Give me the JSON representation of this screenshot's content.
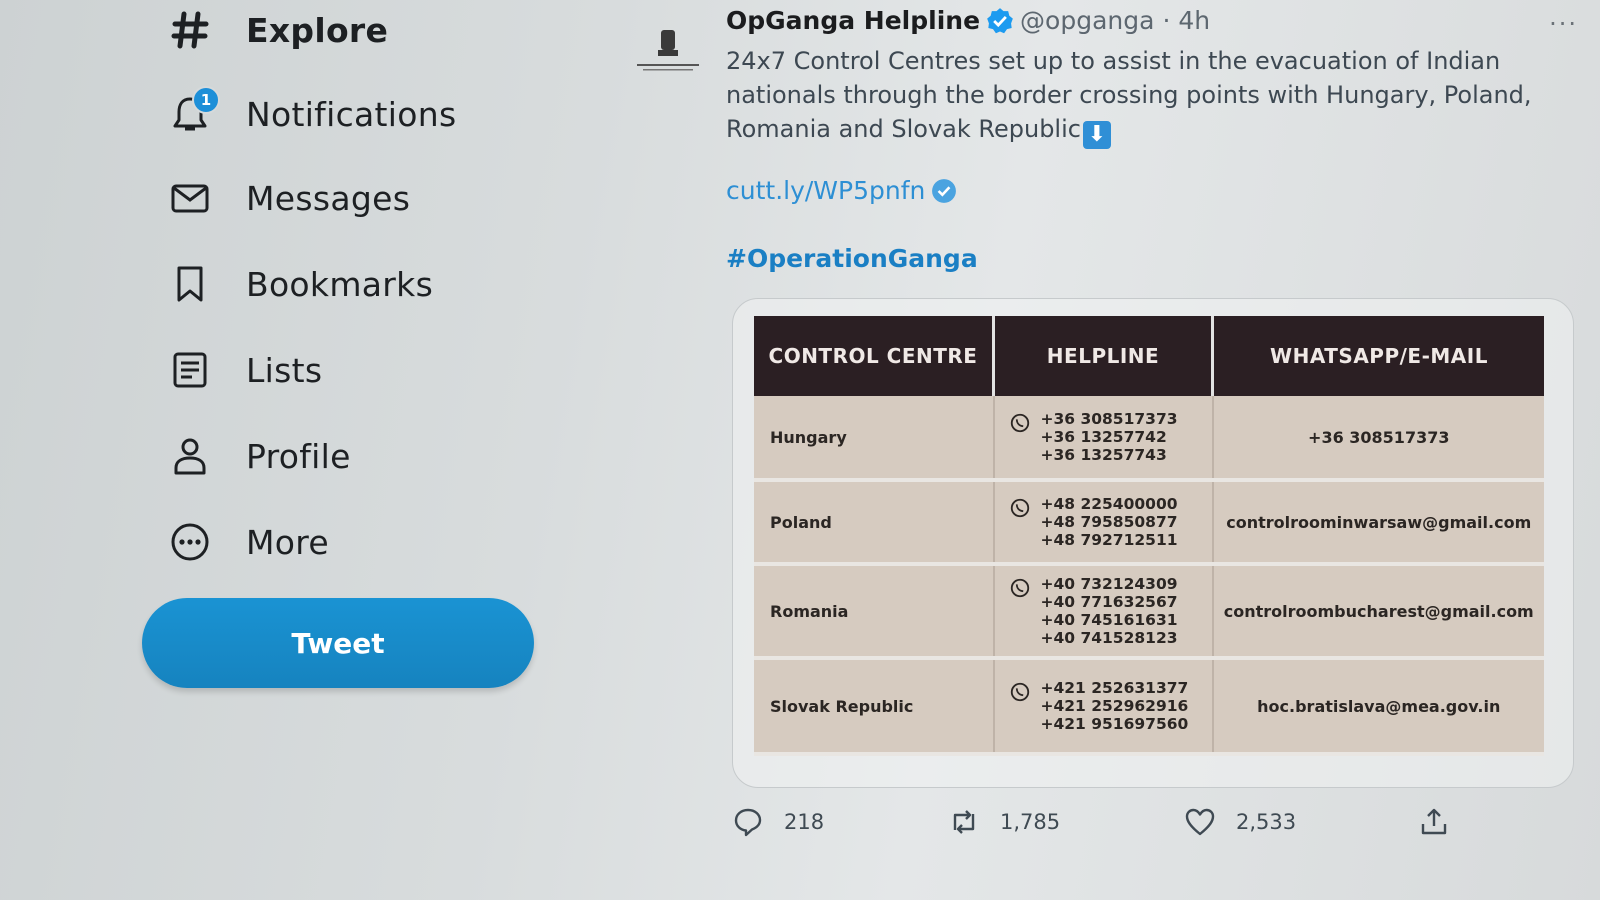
{
  "sidebar": {
    "items": [
      {
        "label": "Explore",
        "icon": "hashtag-icon"
      },
      {
        "label": "Notifications",
        "icon": "bell-icon",
        "badge": "1"
      },
      {
        "label": "Messages",
        "icon": "envelope-icon"
      },
      {
        "label": "Bookmarks",
        "icon": "bookmark-icon"
      },
      {
        "label": "Lists",
        "icon": "list-icon"
      },
      {
        "label": "Profile",
        "icon": "person-icon"
      },
      {
        "label": "More",
        "icon": "more-circle-icon"
      }
    ],
    "tweet_button": "Tweet"
  },
  "tweet": {
    "author": "OpGanga Helpline",
    "handle": "@opganga",
    "time": "· 4h",
    "more": "···",
    "text": "24x7 Control Centres set up to assist in the evacuation of Indian nationals through the border crossing points with Hungary, Poland, Romania and Slovak Republic",
    "link": "cutt.ly/WP5pnfn",
    "hashtag": "#OperationGanga",
    "table": {
      "headers": [
        "CONTROL CENTRE",
        "HELPLINE",
        "WHATSAPP/E-MAIL"
      ],
      "rows": [
        {
          "country": "Hungary",
          "phones": [
            "+36 308517373",
            "+36 13257742",
            "+36 13257743"
          ],
          "contact": "+36 308517373"
        },
        {
          "country": "Poland",
          "phones": [
            "+48 225400000",
            "+48 795850877",
            "+48 792712511"
          ],
          "contact": "controlroominwarsaw@gmail.com"
        },
        {
          "country": "Romania",
          "phones": [
            "+40 732124309",
            "+40 771632567",
            "+40 745161631",
            "+40 741528123"
          ],
          "contact": "controlroombucharest@gmail.com"
        },
        {
          "country": "Slovak Republic",
          "phones": [
            "+421 252631377",
            "+421 252962916",
            "+421 951697560"
          ],
          "contact": "hoc.bratislava@mea.gov.in"
        }
      ]
    },
    "actions": {
      "replies": "218",
      "retweets": "1,785",
      "likes": "2,533"
    }
  },
  "colors": {
    "accent": "#1d9bf0",
    "header_bg": "#2b1f23",
    "cell_bg": "#d6cbc0"
  }
}
